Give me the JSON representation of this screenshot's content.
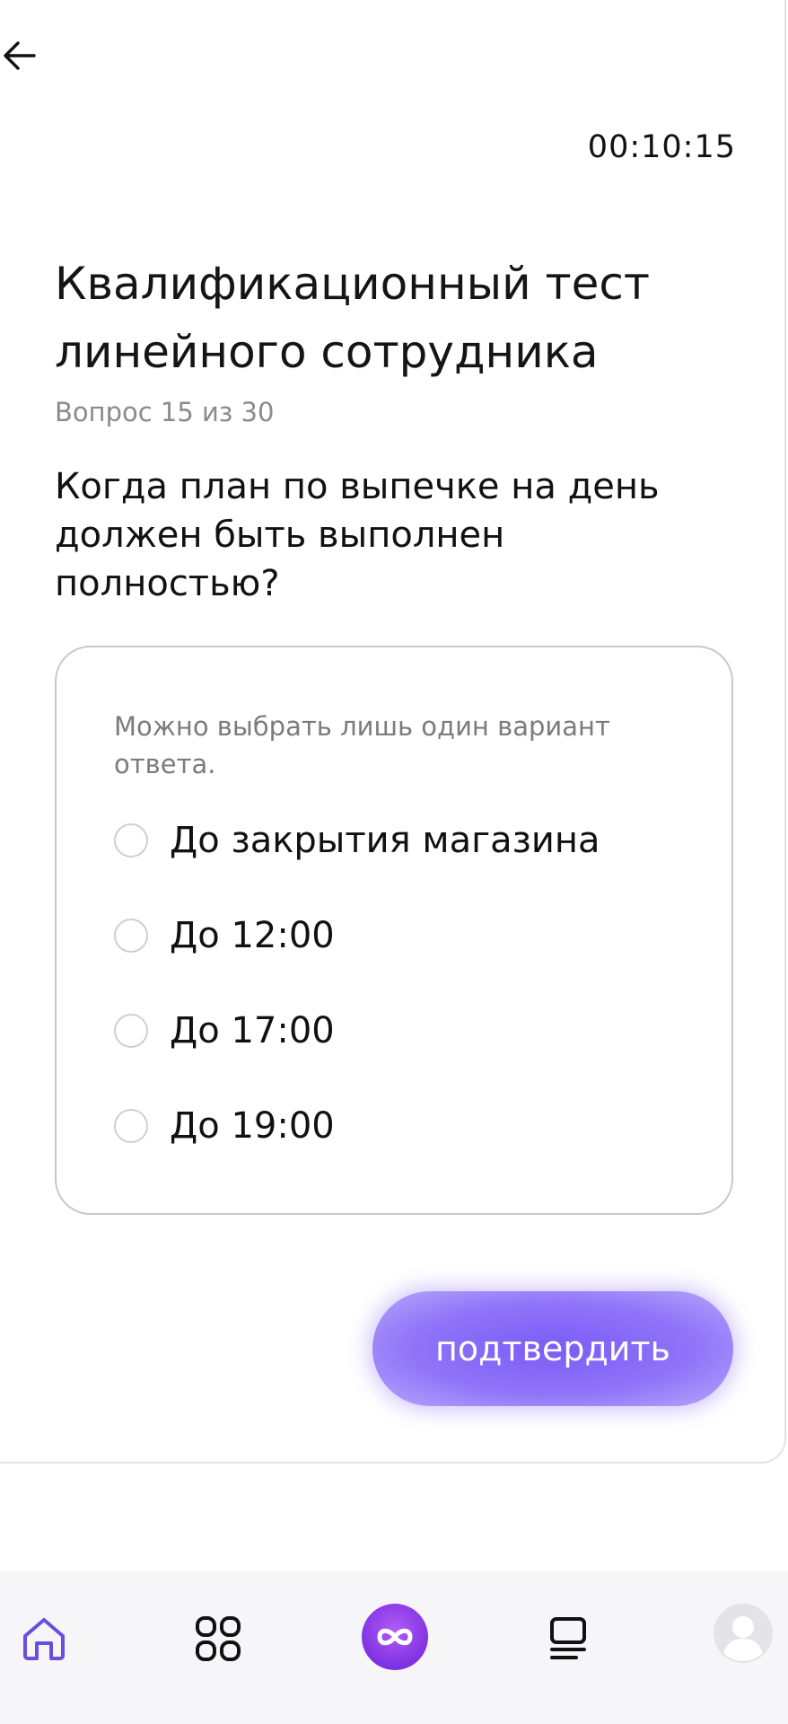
{
  "timer": "00:10:15",
  "test": {
    "title": "Квалификационный тест линейного сотрудника",
    "progress": "Вопрос 15 из 30",
    "question": "Когда план по выпечке на день должен быть выполнен полностью?"
  },
  "answers": {
    "hint": "Можно выбрать лишь один вариант ответа.",
    "options": [
      {
        "label": "До закрытия магазина",
        "selected": false
      },
      {
        "label": "До 12:00",
        "selected": false
      },
      {
        "label": "До 17:00",
        "selected": false
      },
      {
        "label": "До 19:00",
        "selected": false
      }
    ]
  },
  "confirm_label": "подтвердить",
  "colors": {
    "accent": "#7b5cf6",
    "nav_active": "#6a4ee0"
  },
  "bottom_nav": [
    {
      "icon": "home-icon",
      "active": true
    },
    {
      "icon": "grid-icon",
      "active": false
    },
    {
      "icon": "infinity-icon",
      "active": false
    },
    {
      "icon": "courses-icon",
      "active": false
    },
    {
      "icon": "profile-avatar-icon",
      "active": false
    }
  ]
}
